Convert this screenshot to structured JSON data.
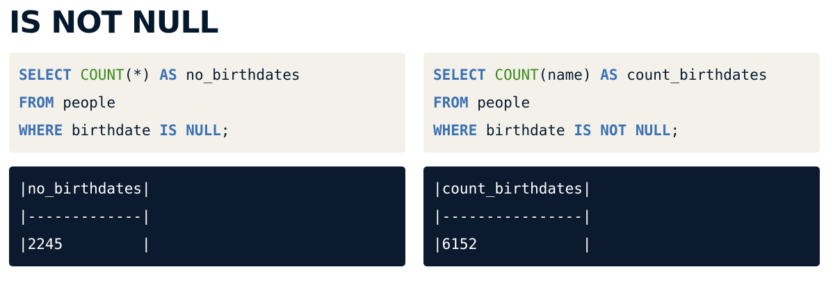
{
  "page": {
    "title": "IS NOT NULL"
  },
  "left_query": {
    "line1": {
      "kw_select": "SELECT",
      "fn_count": "COUNT",
      "args": "(*)",
      "kw_as": "AS",
      "alias": "no_birthdates"
    },
    "line2": {
      "kw_from": "FROM",
      "table": "people"
    },
    "line3": {
      "kw_where": "WHERE",
      "column": "birthdate",
      "kw_is": "IS",
      "kw_null": "NULL",
      "terminator": ";"
    }
  },
  "right_query": {
    "line1": {
      "kw_select": "SELECT",
      "fn_count": "COUNT",
      "args": "(name)",
      "kw_as": "AS",
      "alias": "count_birthdates"
    },
    "line2": {
      "kw_from": "FROM",
      "table": "people"
    },
    "line3": {
      "kw_where": "WHERE",
      "column": "birthdate",
      "kw_is": "IS",
      "kw_not": "NOT",
      "kw_null": "NULL",
      "terminator": ";"
    }
  },
  "left_result": {
    "header": "|no_birthdates|",
    "separator": "|-------------|",
    "row": "|2245         |"
  },
  "right_result": {
    "header": "|count_birthdates|",
    "separator": "|----------------|",
    "row": "|6152            |"
  },
  "colors": {
    "title": "#05192d",
    "code_bg": "#f3f1ea",
    "output_bg": "#0b1a2e",
    "keyword": "#3c71b3",
    "function": "#3a8a1c"
  }
}
